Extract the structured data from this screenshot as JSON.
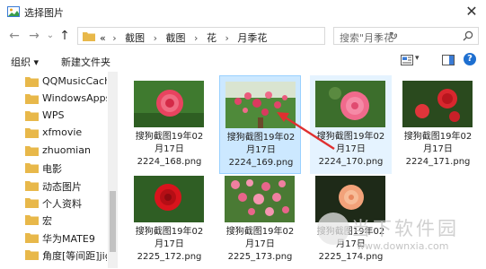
{
  "window": {
    "title": "选择图片",
    "close_glyph": "✕",
    "app_icon": "picture-icon"
  },
  "nav": {
    "back": "←",
    "forward": "→",
    "history": "⌄",
    "up": "↑",
    "breadcrumb": [
      "«",
      "截图",
      "截图",
      "花",
      "月季花"
    ],
    "address_dropdown": "⌄",
    "refresh": "↻",
    "search_placeholder": "搜索\"月季花\""
  },
  "toolbar": {
    "organize": "组织 ▾",
    "new_folder": "新建文件夹",
    "view_dropdown": "▾",
    "help": "?"
  },
  "sidebar": {
    "items": [
      {
        "label": "QQMusicCache"
      },
      {
        "label": "WindowsApps"
      },
      {
        "label": "WPS"
      },
      {
        "label": "xfmovie"
      },
      {
        "label": "zhuomian"
      },
      {
        "label": "电影"
      },
      {
        "label": "动态图片"
      },
      {
        "label": "个人资料"
      },
      {
        "label": "宏"
      },
      {
        "label": "华为MATE9"
      },
      {
        "label": "角度[等间距]jig"
      }
    ]
  },
  "files": [
    {
      "line1": "搜狗截图19年02",
      "line2": "月17日",
      "line3": "2224_168.png",
      "state": "normal"
    },
    {
      "line1": "搜狗截图19年02",
      "line2": "月17日",
      "line3": "2224_169.png",
      "state": "selected"
    },
    {
      "line1": "搜狗截图19年02",
      "line2": "月17日",
      "line3": "2224_170.png",
      "state": "hover"
    },
    {
      "line1": "搜狗截图19年02",
      "line2": "月17日",
      "line3": "2224_171.png",
      "state": "normal"
    },
    {
      "line1": "搜狗截图19年02",
      "line2": "月17日",
      "line3": "2225_172.png",
      "state": "normal"
    },
    {
      "line1": "搜狗截图19年02",
      "line2": "月17日",
      "line3": "2225_173.png",
      "state": "normal"
    },
    {
      "line1": "搜狗截图19年02",
      "line2": "月17日",
      "line3": "2225_174.png",
      "state": "normal"
    }
  ],
  "watermark": {
    "text": "当下软件园",
    "url": "www.downxia.com"
  },
  "colors": {
    "selected_bg": "#cce8ff",
    "hover_bg": "#e5f3ff",
    "folder": "#e8b84a",
    "arrow": "#e03030"
  }
}
